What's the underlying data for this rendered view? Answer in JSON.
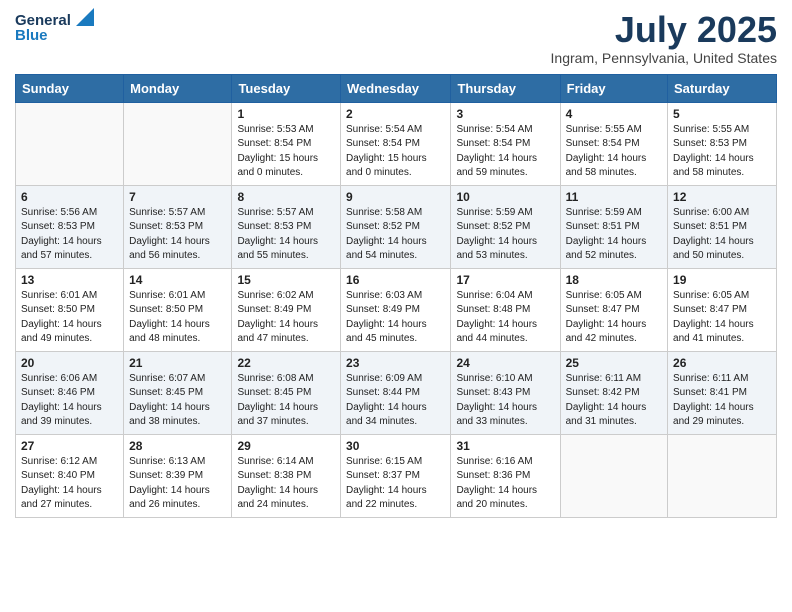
{
  "header": {
    "logo_general": "General",
    "logo_blue": "Blue",
    "month_year": "July 2025",
    "location": "Ingram, Pennsylvania, United States"
  },
  "weekdays": [
    "Sunday",
    "Monday",
    "Tuesday",
    "Wednesday",
    "Thursday",
    "Friday",
    "Saturday"
  ],
  "weeks": [
    [
      {
        "day": "",
        "sunrise": "",
        "sunset": "",
        "daylight": ""
      },
      {
        "day": "",
        "sunrise": "",
        "sunset": "",
        "daylight": ""
      },
      {
        "day": "1",
        "sunrise": "Sunrise: 5:53 AM",
        "sunset": "Sunset: 8:54 PM",
        "daylight": "Daylight: 15 hours and 0 minutes."
      },
      {
        "day": "2",
        "sunrise": "Sunrise: 5:54 AM",
        "sunset": "Sunset: 8:54 PM",
        "daylight": "Daylight: 15 hours and 0 minutes."
      },
      {
        "day": "3",
        "sunrise": "Sunrise: 5:54 AM",
        "sunset": "Sunset: 8:54 PM",
        "daylight": "Daylight: 14 hours and 59 minutes."
      },
      {
        "day": "4",
        "sunrise": "Sunrise: 5:55 AM",
        "sunset": "Sunset: 8:54 PM",
        "daylight": "Daylight: 14 hours and 58 minutes."
      },
      {
        "day": "5",
        "sunrise": "Sunrise: 5:55 AM",
        "sunset": "Sunset: 8:53 PM",
        "daylight": "Daylight: 14 hours and 58 minutes."
      }
    ],
    [
      {
        "day": "6",
        "sunrise": "Sunrise: 5:56 AM",
        "sunset": "Sunset: 8:53 PM",
        "daylight": "Daylight: 14 hours and 57 minutes."
      },
      {
        "day": "7",
        "sunrise": "Sunrise: 5:57 AM",
        "sunset": "Sunset: 8:53 PM",
        "daylight": "Daylight: 14 hours and 56 minutes."
      },
      {
        "day": "8",
        "sunrise": "Sunrise: 5:57 AM",
        "sunset": "Sunset: 8:53 PM",
        "daylight": "Daylight: 14 hours and 55 minutes."
      },
      {
        "day": "9",
        "sunrise": "Sunrise: 5:58 AM",
        "sunset": "Sunset: 8:52 PM",
        "daylight": "Daylight: 14 hours and 54 minutes."
      },
      {
        "day": "10",
        "sunrise": "Sunrise: 5:59 AM",
        "sunset": "Sunset: 8:52 PM",
        "daylight": "Daylight: 14 hours and 53 minutes."
      },
      {
        "day": "11",
        "sunrise": "Sunrise: 5:59 AM",
        "sunset": "Sunset: 8:51 PM",
        "daylight": "Daylight: 14 hours and 52 minutes."
      },
      {
        "day": "12",
        "sunrise": "Sunrise: 6:00 AM",
        "sunset": "Sunset: 8:51 PM",
        "daylight": "Daylight: 14 hours and 50 minutes."
      }
    ],
    [
      {
        "day": "13",
        "sunrise": "Sunrise: 6:01 AM",
        "sunset": "Sunset: 8:50 PM",
        "daylight": "Daylight: 14 hours and 49 minutes."
      },
      {
        "day": "14",
        "sunrise": "Sunrise: 6:01 AM",
        "sunset": "Sunset: 8:50 PM",
        "daylight": "Daylight: 14 hours and 48 minutes."
      },
      {
        "day": "15",
        "sunrise": "Sunrise: 6:02 AM",
        "sunset": "Sunset: 8:49 PM",
        "daylight": "Daylight: 14 hours and 47 minutes."
      },
      {
        "day": "16",
        "sunrise": "Sunrise: 6:03 AM",
        "sunset": "Sunset: 8:49 PM",
        "daylight": "Daylight: 14 hours and 45 minutes."
      },
      {
        "day": "17",
        "sunrise": "Sunrise: 6:04 AM",
        "sunset": "Sunset: 8:48 PM",
        "daylight": "Daylight: 14 hours and 44 minutes."
      },
      {
        "day": "18",
        "sunrise": "Sunrise: 6:05 AM",
        "sunset": "Sunset: 8:47 PM",
        "daylight": "Daylight: 14 hours and 42 minutes."
      },
      {
        "day": "19",
        "sunrise": "Sunrise: 6:05 AM",
        "sunset": "Sunset: 8:47 PM",
        "daylight": "Daylight: 14 hours and 41 minutes."
      }
    ],
    [
      {
        "day": "20",
        "sunrise": "Sunrise: 6:06 AM",
        "sunset": "Sunset: 8:46 PM",
        "daylight": "Daylight: 14 hours and 39 minutes."
      },
      {
        "day": "21",
        "sunrise": "Sunrise: 6:07 AM",
        "sunset": "Sunset: 8:45 PM",
        "daylight": "Daylight: 14 hours and 38 minutes."
      },
      {
        "day": "22",
        "sunrise": "Sunrise: 6:08 AM",
        "sunset": "Sunset: 8:45 PM",
        "daylight": "Daylight: 14 hours and 37 minutes."
      },
      {
        "day": "23",
        "sunrise": "Sunrise: 6:09 AM",
        "sunset": "Sunset: 8:44 PM",
        "daylight": "Daylight: 14 hours and 34 minutes."
      },
      {
        "day": "24",
        "sunrise": "Sunrise: 6:10 AM",
        "sunset": "Sunset: 8:43 PM",
        "daylight": "Daylight: 14 hours and 33 minutes."
      },
      {
        "day": "25",
        "sunrise": "Sunrise: 6:11 AM",
        "sunset": "Sunset: 8:42 PM",
        "daylight": "Daylight: 14 hours and 31 minutes."
      },
      {
        "day": "26",
        "sunrise": "Sunrise: 6:11 AM",
        "sunset": "Sunset: 8:41 PM",
        "daylight": "Daylight: 14 hours and 29 minutes."
      }
    ],
    [
      {
        "day": "27",
        "sunrise": "Sunrise: 6:12 AM",
        "sunset": "Sunset: 8:40 PM",
        "daylight": "Daylight: 14 hours and 27 minutes."
      },
      {
        "day": "28",
        "sunrise": "Sunrise: 6:13 AM",
        "sunset": "Sunset: 8:39 PM",
        "daylight": "Daylight: 14 hours and 26 minutes."
      },
      {
        "day": "29",
        "sunrise": "Sunrise: 6:14 AM",
        "sunset": "Sunset: 8:38 PM",
        "daylight": "Daylight: 14 hours and 24 minutes."
      },
      {
        "day": "30",
        "sunrise": "Sunrise: 6:15 AM",
        "sunset": "Sunset: 8:37 PM",
        "daylight": "Daylight: 14 hours and 22 minutes."
      },
      {
        "day": "31",
        "sunrise": "Sunrise: 6:16 AM",
        "sunset": "Sunset: 8:36 PM",
        "daylight": "Daylight: 14 hours and 20 minutes."
      },
      {
        "day": "",
        "sunrise": "",
        "sunset": "",
        "daylight": ""
      },
      {
        "day": "",
        "sunrise": "",
        "sunset": "",
        "daylight": ""
      }
    ]
  ]
}
